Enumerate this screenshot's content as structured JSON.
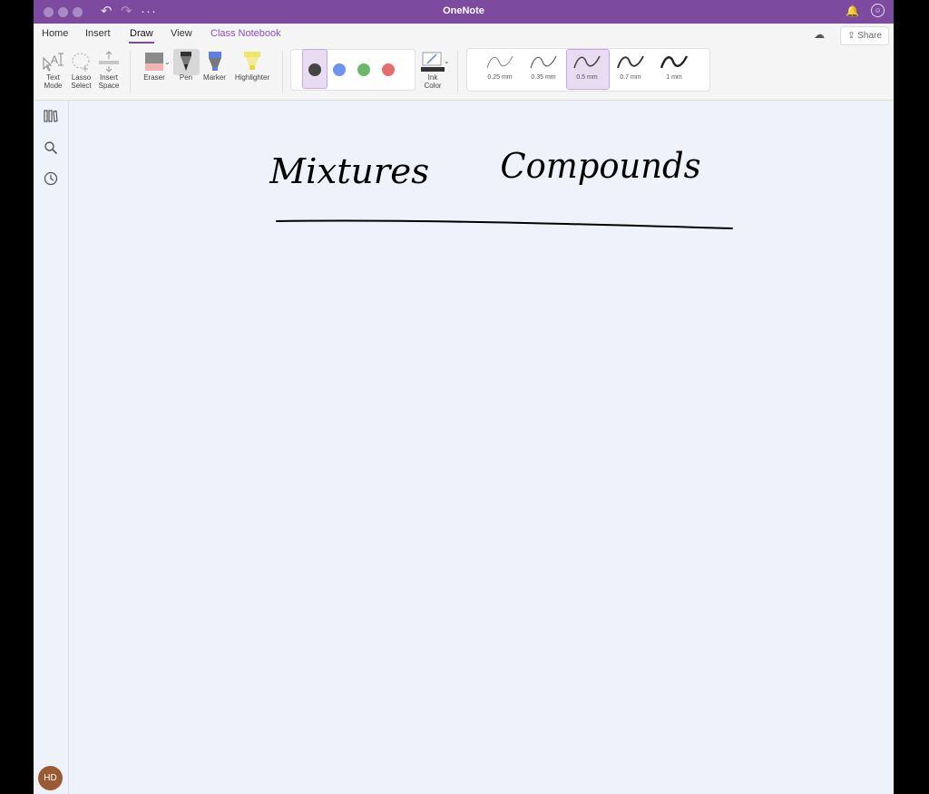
{
  "window": {
    "title": "OneNote",
    "accent_color": "#7c4a9e"
  },
  "ribbon": {
    "tabs": [
      {
        "label": "Home"
      },
      {
        "label": "Insert"
      },
      {
        "label": "Draw"
      },
      {
        "label": "View"
      },
      {
        "label": "Class Notebook"
      }
    ],
    "active_tab": "Draw",
    "share_label": "Share",
    "tools": {
      "text_mode": [
        "Text",
        "Mode"
      ],
      "lasso_select": [
        "Lasso",
        "Select"
      ],
      "insert_space": [
        "Insert",
        "Space"
      ],
      "eraser": "Eraser",
      "pen": "Pen",
      "marker": "Marker",
      "highlighter": "Highlighter",
      "ink_color": [
        "Ink",
        "Color"
      ]
    },
    "pen_colors": [
      "#444444",
      "#6f91ef",
      "#6bb86b",
      "#e96b6b"
    ],
    "selected_color_index": 0,
    "thicknesses": [
      {
        "label": "0.25 mm"
      },
      {
        "label": "0.35 mm"
      },
      {
        "label": "0.5 mm"
      },
      {
        "label": "0.7 mm"
      },
      {
        "label": "1 mm"
      }
    ],
    "selected_thickness_index": 2
  },
  "sidebar": {
    "icons": [
      "notebooks-icon",
      "search-icon",
      "recent-clock-icon"
    ],
    "avatar_initials": "HD",
    "avatar_color": "#9a5a33"
  },
  "canvas": {
    "handwriting": [
      {
        "text": "Mixtures"
      },
      {
        "text": "Compounds"
      }
    ]
  }
}
